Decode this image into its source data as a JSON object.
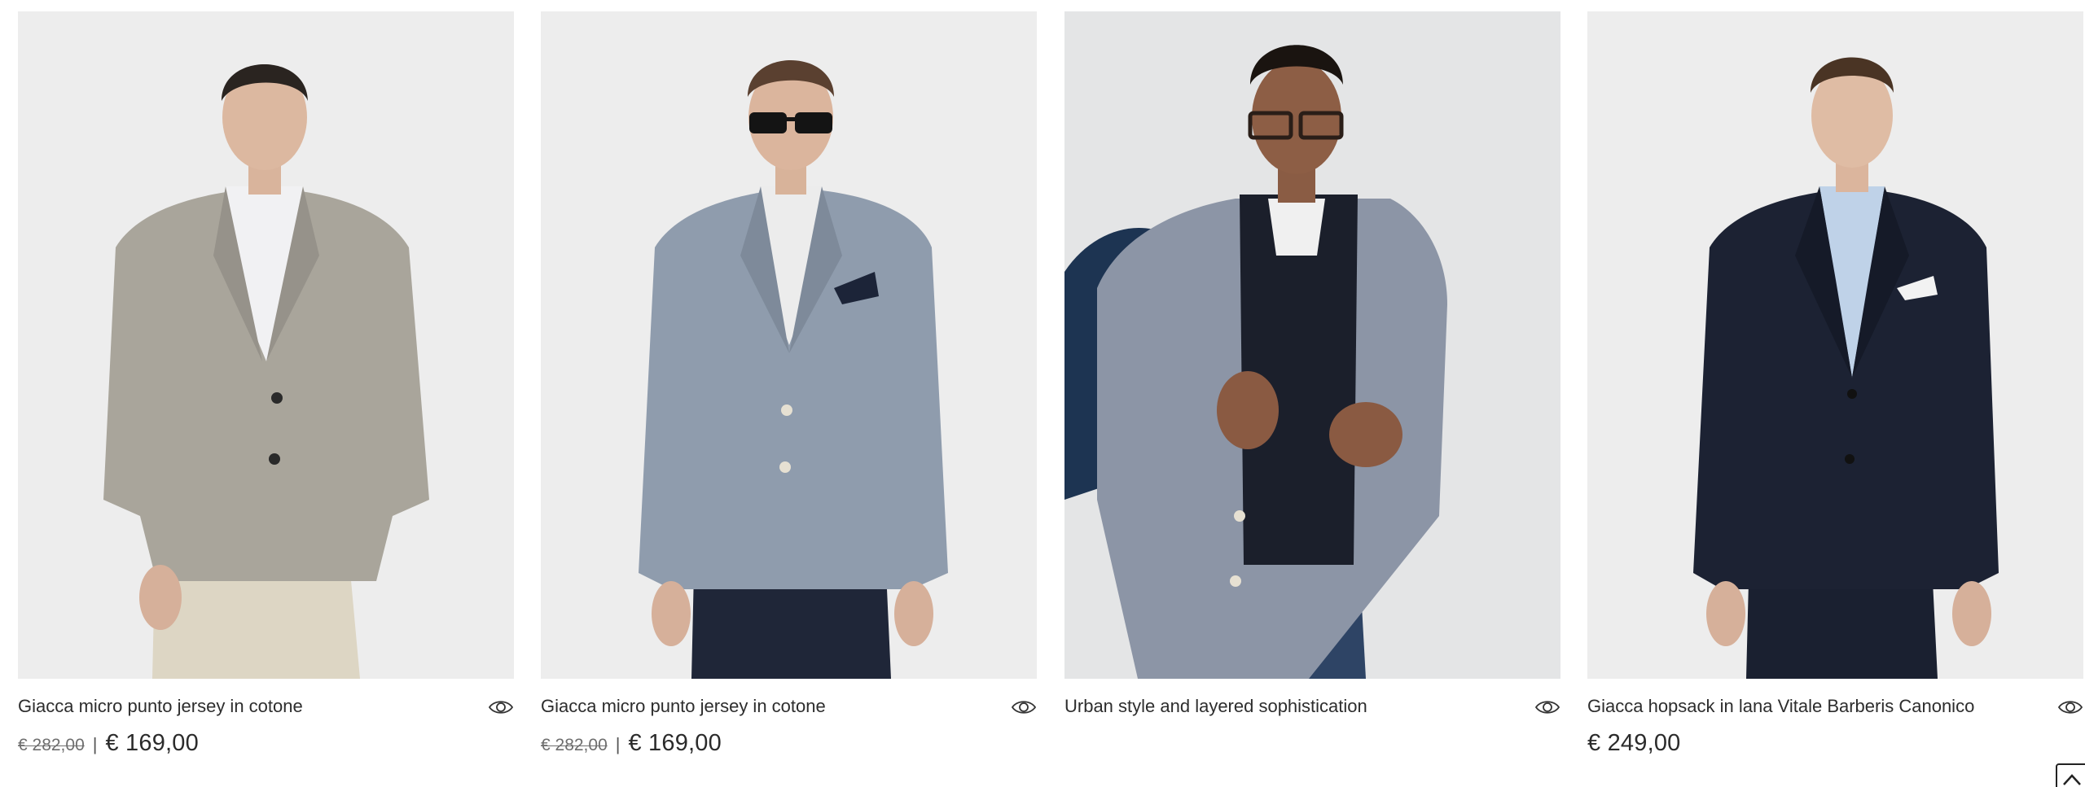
{
  "products": [
    {
      "name": "Giacca micro punto jersey in cotone",
      "price_old": "€ 282,00",
      "separator": "|",
      "price_now": "€ 169,00",
      "image_alt": "Giacca micro punto jersey in cotone",
      "jacket_color": "#a9a59b",
      "shirt_color": "#f1f1f3",
      "trouser_color": "#ddd6c4"
    },
    {
      "name": "Giacca micro punto jersey in cotone",
      "price_old": "€ 282,00",
      "separator": "|",
      "price_now": "€ 169,00",
      "image_alt": "Giacca micro punto jersey in cotone",
      "jacket_color": "#8f9cad",
      "shirt_color": "#ececec",
      "trouser_color": "#1f2638"
    },
    {
      "name": "Urban style and layered sophistication",
      "price_old": "",
      "separator": "",
      "price_now": "",
      "image_alt": "Urban style and layered sophistication",
      "jacket_color": "#8c95a6",
      "shirt_color": "#1b1f2b",
      "trouser_color": "#2e4465"
    },
    {
      "name": "Giacca hopsack in lana Vitale Barberis Canonico",
      "price_old": "",
      "separator": "",
      "price_now": "€ 249,00",
      "image_alt": "Giacca hopsack in lana Vitale Barberis Canonico",
      "jacket_color": "#1c2233",
      "shirt_color": "#bfd2e8",
      "trouser_color": "#1a2030"
    }
  ],
  "icons": {
    "quick_view": "eye-icon",
    "back_to_top": "chevron-up-icon"
  }
}
